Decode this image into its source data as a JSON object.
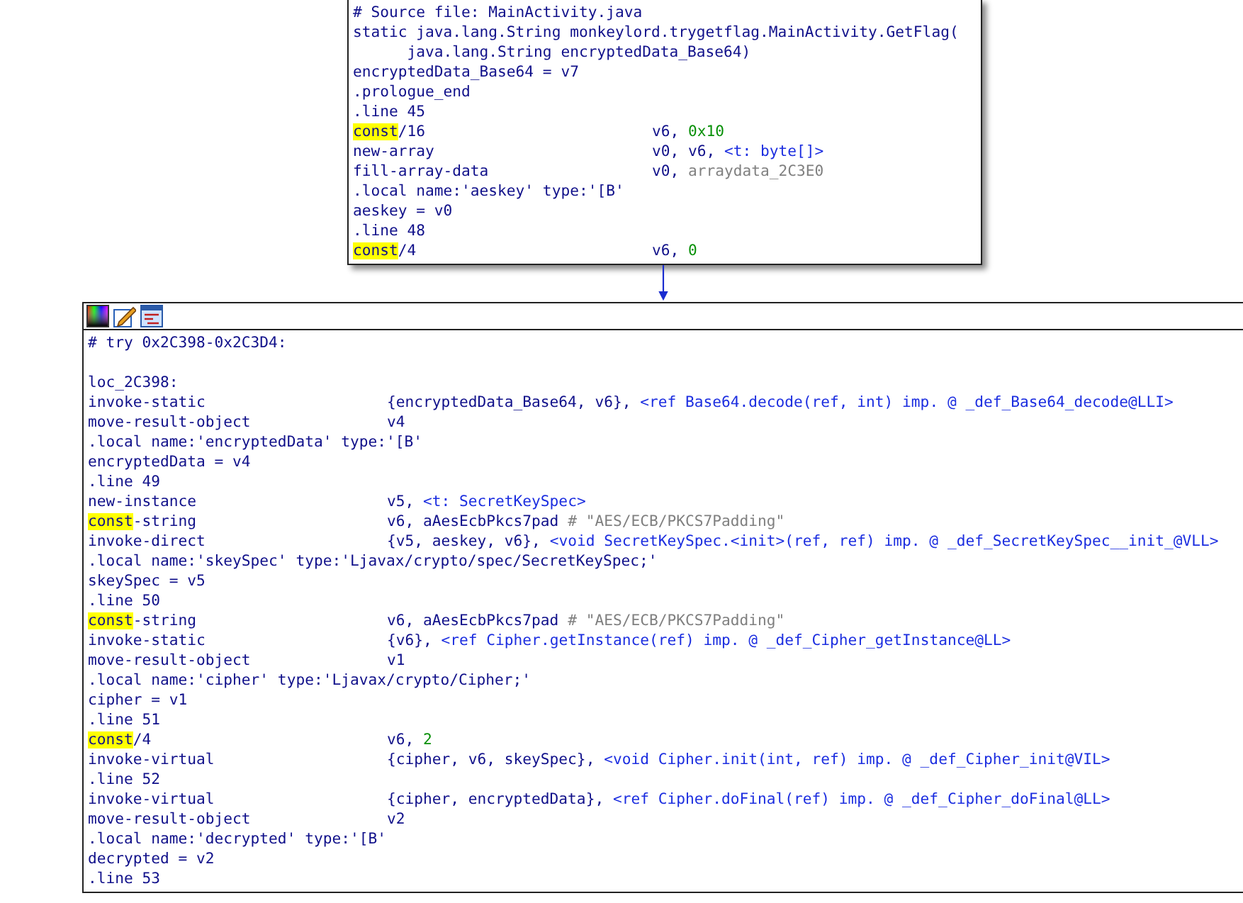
{
  "nodes": [
    {
      "kind": "block",
      "sections": [
        {
          "lines": [
            {
              "op": "# Source file: MainActivity.java"
            },
            {
              "op": "static java.lang.String monkeylord.trygetflag.MainActivity.GetFlag("
            },
            {
              "op": "      java.lang.String encryptedData_Base64)"
            },
            {
              "op": "encryptedData_Base64 = v7"
            },
            {
              "op": ".prologue_end"
            },
            {
              "op": ".line 45"
            },
            {
              "hl": "const",
              "op": "/16",
              "args": [
                {
                  "kind": "plain",
                  "text": "v6, "
                },
                {
                  "kind": "num",
                  "text": "0x10"
                }
              ]
            },
            {
              "op": "new-array",
              "args": [
                {
                  "kind": "plain",
                  "text": "v0, v6, "
                },
                {
                  "kind": "ref",
                  "text": "<t: byte[]>"
                }
              ]
            },
            {
              "op": "fill-array-data",
              "args": [
                {
                  "kind": "plain",
                  "text": "v0, "
                },
                {
                  "kind": "gray",
                  "text": "arraydata_2C3E0"
                }
              ]
            },
            {
              "op": ".local name:'aeskey' type:'[B'"
            },
            {
              "op": "aeskey = v0"
            },
            {
              "op": ".line 48"
            },
            {
              "hl": "const",
              "op": "/4",
              "args": [
                {
                  "kind": "plain",
                  "text": "v6, "
                },
                {
                  "kind": "num",
                  "text": "0"
                }
              ]
            }
          ]
        }
      ]
    },
    {
      "kind": "toolbar-block",
      "sections": [
        {
          "lines": [
            {
              "op": "# try 0x2C398-0x2C3D4:"
            }
          ]
        },
        {
          "lines": [
            {
              "op": "loc_2C398:"
            },
            {
              "op": "invoke-static",
              "args": [
                {
                  "kind": "plain",
                  "text": "{encryptedData_Base64, v6}, "
                },
                {
                  "kind": "ref",
                  "text": "<ref Base64.decode(ref, int) imp. @ _def_Base64_decode@LLI>"
                }
              ]
            },
            {
              "op": "move-result-object",
              "args": [
                {
                  "kind": "plain",
                  "text": "v4"
                }
              ]
            },
            {
              "op": ".local name:'encryptedData' type:'[B'"
            },
            {
              "op": "encryptedData = v4"
            },
            {
              "op": ".line 49"
            },
            {
              "op": "new-instance",
              "args": [
                {
                  "kind": "plain",
                  "text": "v5, "
                },
                {
                  "kind": "ref",
                  "text": "<t: SecretKeySpec>"
                }
              ]
            },
            {
              "hl": "const",
              "op": "-string",
              "args": [
                {
                  "kind": "plain",
                  "text": "v6, aAesEcbPkcs7pad "
                },
                {
                  "kind": "gray",
                  "text": "# \"AES/ECB/PKCS7Padding\""
                }
              ]
            },
            {
              "op": "invoke-direct",
              "args": [
                {
                  "kind": "plain",
                  "text": "{v5, aeskey, v6}, "
                },
                {
                  "kind": "ref",
                  "text": "<void SecretKeySpec.<init>(ref, ref) imp. @ _def_SecretKeySpec__init_@VLL>"
                }
              ]
            },
            {
              "op": ".local name:'skeySpec' type:'Ljavax/crypto/spec/SecretKeySpec;'"
            },
            {
              "op": "skeySpec = v5"
            },
            {
              "op": ".line 50"
            },
            {
              "hl": "const",
              "op": "-string",
              "args": [
                {
                  "kind": "plain",
                  "text": "v6, aAesEcbPkcs7pad "
                },
                {
                  "kind": "gray",
                  "text": "# \"AES/ECB/PKCS7Padding\""
                }
              ]
            },
            {
              "op": "invoke-static",
              "args": [
                {
                  "kind": "plain",
                  "text": "{v6}, "
                },
                {
                  "kind": "ref",
                  "text": "<ref Cipher.getInstance(ref) imp. @ _def_Cipher_getInstance@LL>"
                }
              ]
            },
            {
              "op": "move-result-object",
              "args": [
                {
                  "kind": "plain",
                  "text": "v1"
                }
              ]
            },
            {
              "op": ".local name:'cipher' type:'Ljavax/crypto/Cipher;'"
            },
            {
              "op": "cipher = v1"
            },
            {
              "op": ".line 51"
            },
            {
              "hl": "const",
              "op": "/4",
              "args": [
                {
                  "kind": "plain",
                  "text": "v6, "
                },
                {
                  "kind": "num",
                  "text": "2"
                }
              ]
            },
            {
              "op": "invoke-virtual",
              "args": [
                {
                  "kind": "plain",
                  "text": "{cipher, v6, skeySpec}, "
                },
                {
                  "kind": "ref",
                  "text": "<void Cipher.init(int, ref) imp. @ _def_Cipher_init@VIL>"
                }
              ]
            },
            {
              "op": ".line 52"
            },
            {
              "op": "invoke-virtual",
              "args": [
                {
                  "kind": "plain",
                  "text": "{cipher, encryptedData}, "
                },
                {
                  "kind": "ref",
                  "text": "<ref Cipher.doFinal(ref) imp. @ _def_Cipher_doFinal@LL>"
                }
              ]
            },
            {
              "op": "move-result-object",
              "args": [
                {
                  "kind": "plain",
                  "text": "v2"
                }
              ]
            },
            {
              "op": ".local name:'decrypted' type:'[B'"
            },
            {
              "op": "decrypted = v2"
            },
            {
              "op": ".line 53"
            }
          ]
        }
      ]
    }
  ]
}
